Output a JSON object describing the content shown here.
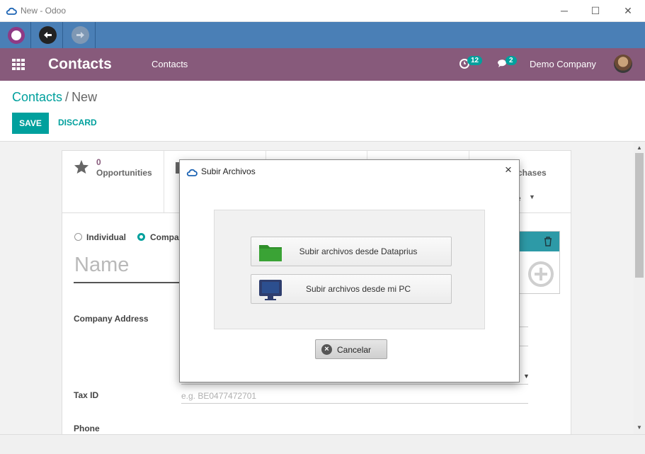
{
  "window": {
    "title": "New - Odoo",
    "minimize": "─",
    "maximize": "☐",
    "close": "✕"
  },
  "navbar": {
    "brand": "Contacts",
    "menu_item": "Contacts",
    "activity_count": "12",
    "message_count": "2",
    "company": "Demo Company"
  },
  "breadcrumb": {
    "parent": "Contacts",
    "separator": "/",
    "current": "New"
  },
  "buttons": {
    "save": "SAVE",
    "discard": "DISCARD"
  },
  "smart_buttons": {
    "opportunities_count": "0",
    "opportunities_label": "Opportunities",
    "purchases_fragment": "chases",
    "more_fragment": "e"
  },
  "form": {
    "radio_individual": "Individual",
    "radio_company": "Compa",
    "name_placeholder": "Name",
    "company_address_label": "Company Address",
    "tax_id_label": "Tax ID",
    "tax_id_placeholder": "e.g. BE0477472701",
    "phone_label": "Phone"
  },
  "modal": {
    "title": "Subir Archivos",
    "close": "×",
    "option_dataprius": "Subir archivos desde Dataprius",
    "option_pc": "Subir archivos desde mi PC",
    "cancel": "Cancelar"
  },
  "colors": {
    "odoo_purple": "#875a7b",
    "teal": "#00a09d",
    "toolbar_blue": "#4a7fb6",
    "folder_green": "#3aa335",
    "monitor_navy": "#2f3e6e"
  }
}
